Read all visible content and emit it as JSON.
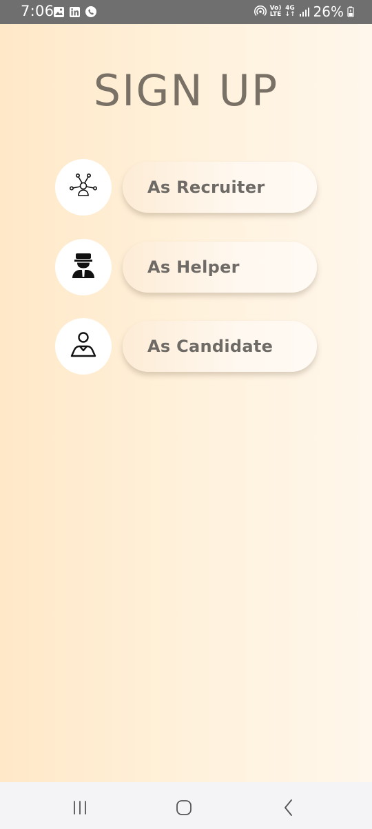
{
  "status_bar": {
    "time": "7:06",
    "network_top": "Vo)",
    "network_bottom": "LTE",
    "signal_top": "4G",
    "signal_bottom": "↓↑",
    "battery_percent": "26%",
    "icons_left": [
      "gallery-icon",
      "linkedin-icon",
      "viber-icon"
    ],
    "icons_right": [
      "hotspot-icon",
      "volte-icon",
      "4g-icon",
      "signal-icon",
      "battery-icon"
    ]
  },
  "page": {
    "title": "SIGN UP"
  },
  "options": [
    {
      "label": "As Recruiter",
      "icon": "recruiter-network-icon"
    },
    {
      "label": "As Helper",
      "icon": "helper-person-icon"
    },
    {
      "label": "As Candidate",
      "icon": "candidate-person-icon"
    }
  ],
  "nav_bar": {
    "buttons": [
      "recent-apps-icon",
      "home-icon",
      "back-icon"
    ]
  },
  "colors": {
    "status_bar_bg": "#6f6f6f",
    "gradient_start": "#ffe8c8",
    "gradient_end": "#fff7ec",
    "title_color": "#7a7166",
    "pill_text": "#6e6a66",
    "nav_bar_bg": "#f4f3f6"
  }
}
